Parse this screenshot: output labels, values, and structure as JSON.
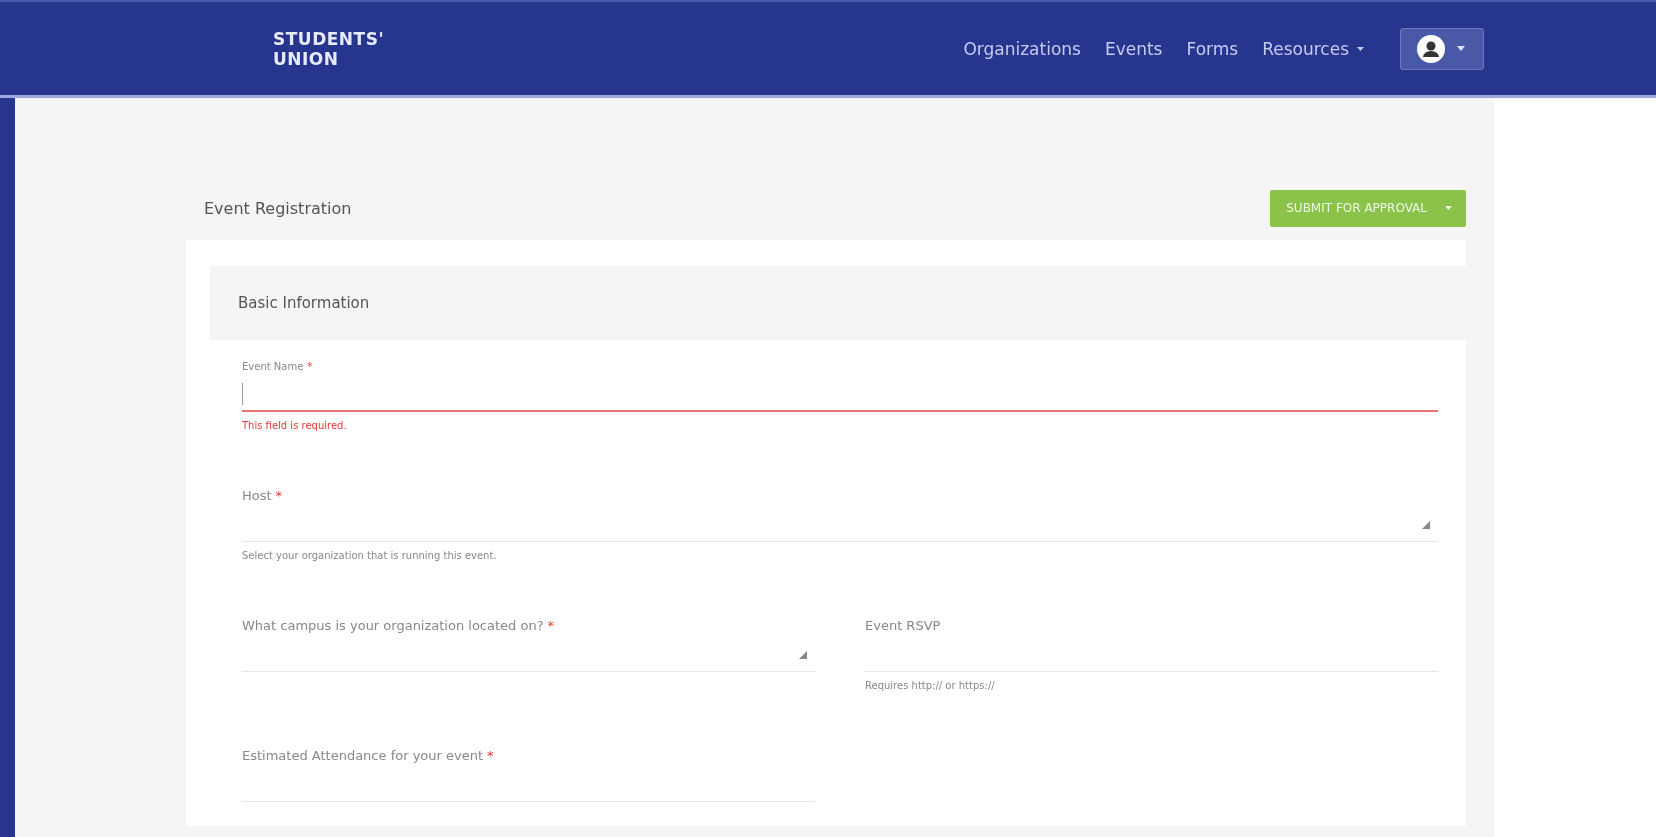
{
  "header": {
    "logo": [
      "STUDENTS'",
      "UNION"
    ],
    "nav": [
      {
        "label": "Organizations",
        "dropdown": false
      },
      {
        "label": "Events",
        "dropdown": false
      },
      {
        "label": "Forms",
        "dropdown": false
      },
      {
        "label": "Resources",
        "dropdown": true
      }
    ]
  },
  "page": {
    "title": "Event Registration",
    "submit": "SUBMIT FOR APPROVAL"
  },
  "section": {
    "title": "Basic Information",
    "fields": [
      {
        "kind": "text",
        "label": "Event Name",
        "required_mark": "*",
        "wide": true,
        "error": "This field is required."
      },
      {
        "kind": "select",
        "label": "Host",
        "required_mark": "*",
        "wide": true,
        "hint": "Select your organization that is running this event."
      },
      {
        "kind": "select",
        "label": "What campus is your organization located on?",
        "required_mark": "*",
        "wide": false
      },
      {
        "kind": "text",
        "label": "Event RSVP",
        "wide": false,
        "hint": "Requires http:// or https://"
      },
      {
        "kind": "text",
        "label": "Estimated Attendance for your event",
        "required_mark": "*",
        "wide": false
      }
    ]
  }
}
